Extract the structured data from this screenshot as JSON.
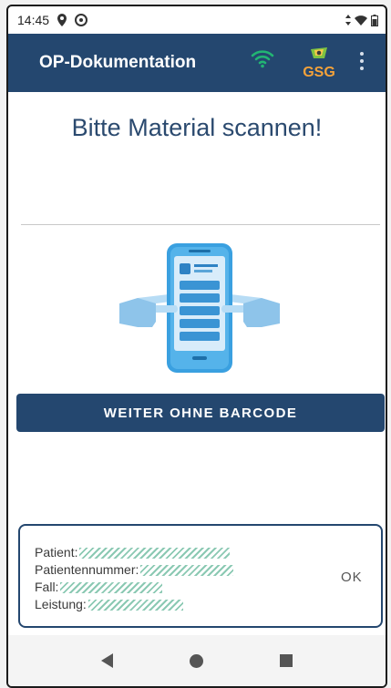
{
  "status_bar": {
    "time": "14:45"
  },
  "app_bar": {
    "title": "OP-Dokumentation",
    "logo_text": "GSG"
  },
  "main": {
    "heading": "Bitte Material scannen!",
    "continue_button": "WEITER OHNE BARCODE"
  },
  "info_card": {
    "patient_label": "Patient:",
    "patient_number_label": "Patientennummer:",
    "case_label": "Fall:",
    "service_label": "Leistung:",
    "ok_label": "OK"
  },
  "colors": {
    "primary": "#24476f",
    "wifi": "#22b573",
    "heading": "#2b4a6f"
  }
}
